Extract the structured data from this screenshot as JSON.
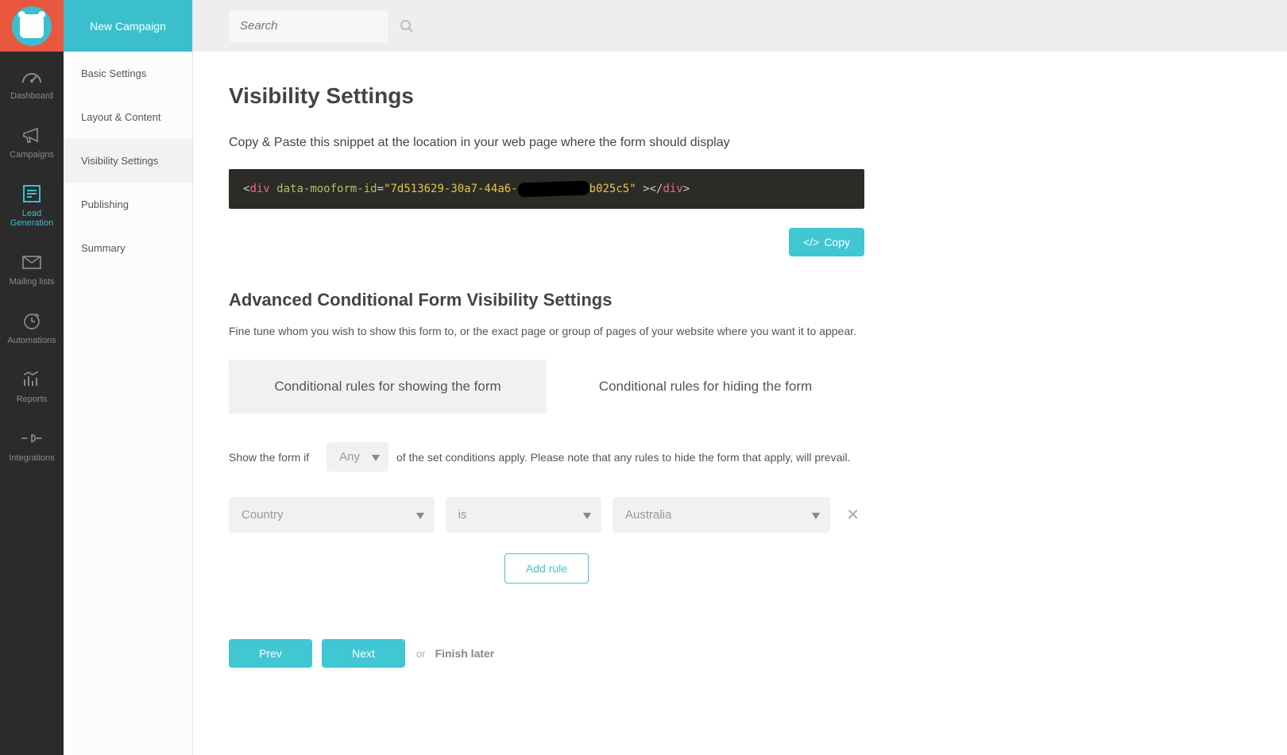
{
  "header": {
    "new_campaign": "New Campaign",
    "search_placeholder": "Search"
  },
  "nav": [
    {
      "label": "Dashboard"
    },
    {
      "label": "Campaigns"
    },
    {
      "label": "Lead Generation"
    },
    {
      "label": "Mailing lists"
    },
    {
      "label": "Automations"
    },
    {
      "label": "Reports"
    },
    {
      "label": "Integrations"
    }
  ],
  "subnav": [
    "Basic Settings",
    "Layout & Content",
    "Visibility Settings",
    "Publishing",
    "Summary"
  ],
  "page": {
    "title": "Visibility Settings",
    "instruction": "Copy & Paste this snippet at the location in your web page where the form should display",
    "snippet_attr": "data-mooform-id",
    "snippet_id_prefix": "7d513629-30a7-44a6-",
    "snippet_id_suffix": "b025c5",
    "copy_btn": "Copy",
    "advanced_title": "Advanced Conditional Form Visibility Settings",
    "advanced_sub": "Fine tune whom you wish to show this form to, or the exact page or group of pages of your website where you want it to appear.",
    "tab_show": "Conditional rules for showing the form",
    "tab_hide": "Conditional rules for hiding the form",
    "rule_prefix": "Show the form if",
    "any_label": "Any",
    "rule_suffix": "of the set conditions apply. Please note that any rules to hide the form that apply, will prevail.",
    "sel_field": "Country",
    "sel_op": "is",
    "sel_val": "Australia",
    "add_rule": "Add rule",
    "prev": "Prev",
    "next": "Next",
    "or": "or",
    "finish": "Finish later"
  }
}
